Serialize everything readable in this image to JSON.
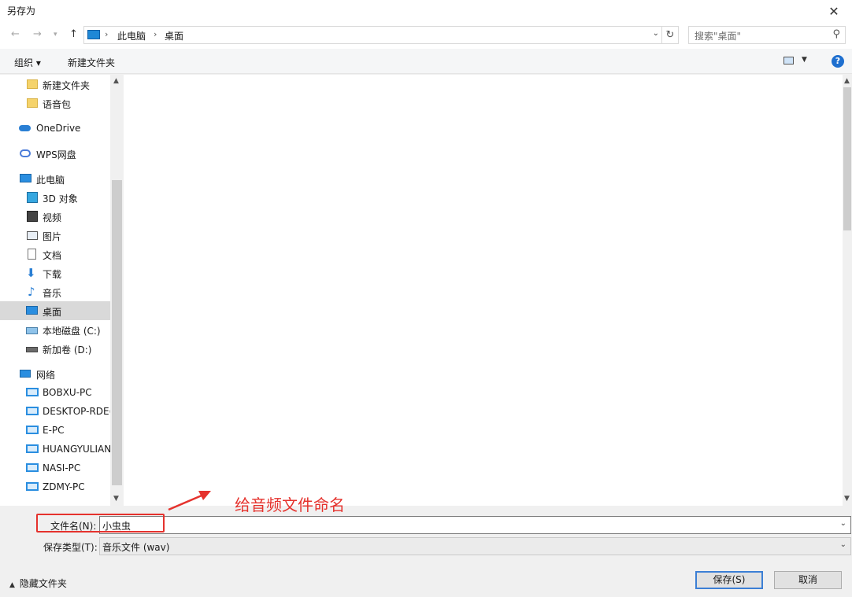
{
  "window": {
    "title": "另存为"
  },
  "address": {
    "crumbs": [
      "此电脑",
      "桌面"
    ],
    "search_placeholder": "搜索\"桌面\""
  },
  "toolbar": {
    "organize_label": "组织 ▾",
    "new_folder_label": "新建文件夹"
  },
  "nav": {
    "items": [
      {
        "label": "新建文件夹",
        "icon": "folder-icon"
      },
      {
        "label": "语音包",
        "icon": "folder-icon"
      },
      {
        "label": "OneDrive",
        "icon": "onedrive-cloud-icon"
      },
      {
        "label": "WPS网盘",
        "icon": "wps-cloud-icon"
      },
      {
        "label": "此电脑",
        "icon": "this-pc-icon"
      },
      {
        "label": "3D 对象",
        "icon": "3d-objects-icon"
      },
      {
        "label": "视频",
        "icon": "video-icon"
      },
      {
        "label": "图片",
        "icon": "pictures-icon"
      },
      {
        "label": "文档",
        "icon": "documents-icon"
      },
      {
        "label": "下载",
        "icon": "download-arrow-icon"
      },
      {
        "label": "音乐",
        "icon": "music-note-icon"
      },
      {
        "label": "桌面",
        "icon": "desktop-icon",
        "selected": true
      },
      {
        "label": "本地磁盘 (C:)",
        "icon": "drive-c-icon"
      },
      {
        "label": "新加卷 (D:)",
        "icon": "drive-icon"
      },
      {
        "label": "网络",
        "icon": "network-icon"
      },
      {
        "label": "BOBXU-PC",
        "icon": "network-computer-icon"
      },
      {
        "label": "DESKTOP-RDE(",
        "icon": "network-computer-icon"
      },
      {
        "label": "E-PC",
        "icon": "network-computer-icon"
      },
      {
        "label": "HUANGYULIAN",
        "icon": "network-computer-icon"
      },
      {
        "label": "NASI-PC",
        "icon": "network-computer-icon"
      },
      {
        "label": "ZDMY-PC",
        "icon": "network-computer-icon"
      }
    ]
  },
  "annotation": {
    "text": "给音频文件命名",
    "color": "#e5322d"
  },
  "form": {
    "filename_label": "文件名(N):",
    "filename_value": "小虫虫",
    "filetype_label": "保存类型(T):",
    "filetype_value": "音乐文件 (wav)"
  },
  "footer": {
    "hide_folders_label": "隐藏文件夹",
    "save_label": "保存(S)",
    "cancel_label": "取消"
  }
}
